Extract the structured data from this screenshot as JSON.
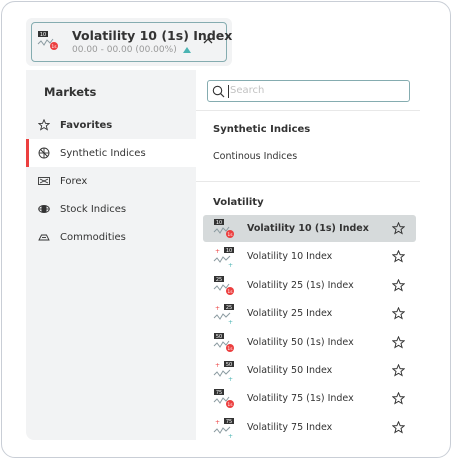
{
  "selector": {
    "title": "Volatility 10 (1s) Index",
    "subtitle": "00.00 - 00.00 (00.00%)",
    "icon": "volatility-1s-icon",
    "icon_badge": "10"
  },
  "sidebar": {
    "title": "Markets",
    "items": [
      {
        "label": "Favorites",
        "icon": "star-icon",
        "bold": true,
        "active": false
      },
      {
        "label": "Synthetic Indices",
        "icon": "synthetic-icon",
        "bold": false,
        "active": true
      },
      {
        "label": "Forex",
        "icon": "forex-icon",
        "bold": false,
        "active": false
      },
      {
        "label": "Stock Indices",
        "icon": "stock-indices-icon",
        "bold": false,
        "active": false
      },
      {
        "label": "Commodities",
        "icon": "commodities-icon",
        "bold": false,
        "active": false
      }
    ]
  },
  "search": {
    "placeholder": "Search"
  },
  "synthetic_section": {
    "title": "Synthetic Indices",
    "link": "Continous Indices"
  },
  "volatility_section": {
    "title": "Volatility",
    "markets": [
      {
        "name": "Volatility 10 (1s) Index",
        "badge": "10",
        "kind": "1s",
        "selected": true
      },
      {
        "name": "Volatility 10 Index",
        "badge": "10",
        "kind": "std",
        "selected": false
      },
      {
        "name": "Volatility 25 (1s) Index",
        "badge": "25",
        "kind": "1s",
        "selected": false
      },
      {
        "name": "Volatility 25 Index",
        "badge": "25",
        "kind": "std",
        "selected": false
      },
      {
        "name": "Volatility 50 (1s) Index",
        "badge": "50",
        "kind": "1s",
        "selected": false
      },
      {
        "name": "Volatility 50 Index",
        "badge": "50",
        "kind": "std",
        "selected": false
      },
      {
        "name": "Volatility 75 (1s) Index",
        "badge": "75",
        "kind": "1s",
        "selected": false
      },
      {
        "name": "Volatility 75 Index",
        "badge": "75",
        "kind": "std",
        "selected": false
      }
    ]
  },
  "colors": {
    "accent_red": "#ec3f3f",
    "teal_up": "#4bb4b3",
    "border": "#85acb0",
    "panel_bg": "#f2f3f4",
    "selected_row": "#d6dadb"
  }
}
